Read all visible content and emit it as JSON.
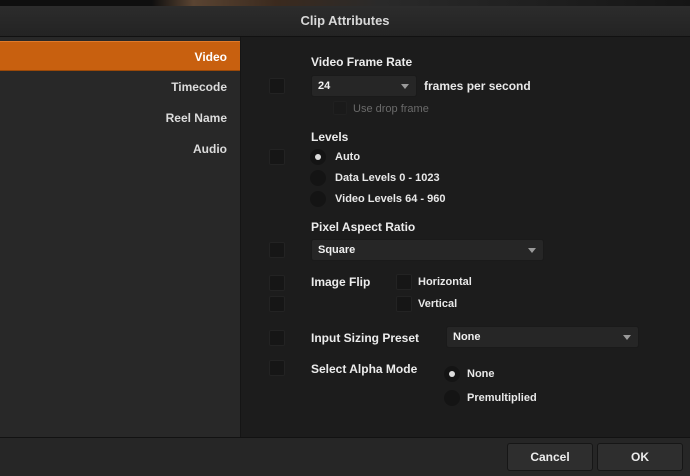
{
  "window": {
    "title": "Clip Attributes"
  },
  "sidebar": {
    "items": [
      {
        "label": "Video",
        "active": true
      },
      {
        "label": "Timecode",
        "active": false
      },
      {
        "label": "Reel Name",
        "active": false
      },
      {
        "label": "Audio",
        "active": false
      }
    ]
  },
  "video_frame_rate": {
    "heading": "Video Frame Rate",
    "value": "24",
    "suffix": "frames per second",
    "drop_frame_label": "Use drop frame"
  },
  "levels": {
    "heading": "Levels",
    "options": [
      {
        "label": "Auto",
        "selected": true
      },
      {
        "label": "Data Levels 0 - 1023",
        "selected": false
      },
      {
        "label": "Video Levels 64 - 960",
        "selected": false
      }
    ]
  },
  "pixel_aspect_ratio": {
    "heading": "Pixel Aspect Ratio",
    "value": "Square"
  },
  "image_flip": {
    "heading": "Image Flip",
    "horizontal_label": "Horizontal",
    "vertical_label": "Vertical"
  },
  "input_sizing_preset": {
    "heading": "Input Sizing Preset",
    "value": "None"
  },
  "alpha_mode": {
    "heading": "Select Alpha Mode",
    "options": [
      {
        "label": "None",
        "selected": true
      },
      {
        "label": "Premultiplied",
        "selected": false
      }
    ]
  },
  "footer": {
    "cancel_label": "Cancel",
    "ok_label": "OK"
  },
  "colors": {
    "accent": "#c8600f",
    "background": "#1c1c1c",
    "sidebar": "#282828"
  }
}
